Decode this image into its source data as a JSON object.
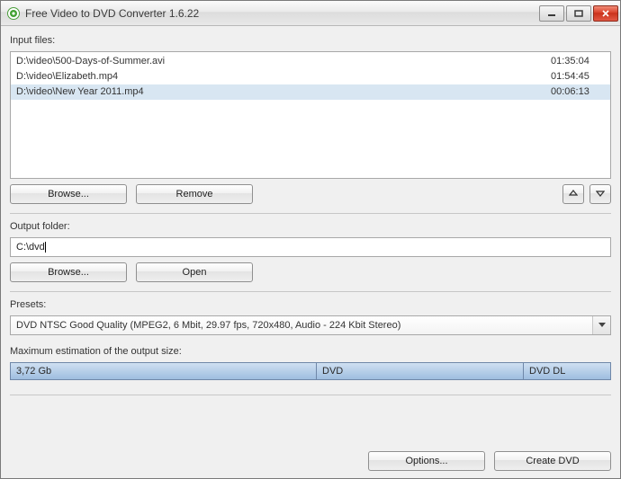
{
  "titlebar": {
    "title": "Free Video to DVD Converter 1.6.22"
  },
  "labels": {
    "input_files": "Input files:",
    "output_folder": "Output folder:",
    "presets": "Presets:",
    "max_est": "Maximum estimation of the output size:"
  },
  "input_files": [
    {
      "path": "D:\\video\\500-Days-of-Summer.avi",
      "duration": "01:35:04",
      "selected": false
    },
    {
      "path": "D:\\video\\Elizabeth.mp4",
      "duration": "01:54:45",
      "selected": false
    },
    {
      "path": "D:\\video\\New Year 2011.mp4",
      "duration": "00:06:13",
      "selected": true
    }
  ],
  "buttons": {
    "browse_files": "Browse...",
    "remove": "Remove",
    "browse_folder": "Browse...",
    "open": "Open",
    "options": "Options...",
    "create": "Create DVD"
  },
  "output_folder": {
    "value": "C:\\dvd"
  },
  "preset": {
    "selected": "DVD NTSC Good Quality (MPEG2, 6 Mbit, 29.97 fps, 720x480, Audio - 224 Kbit Stereo)"
  },
  "estimation": {
    "size": "3,72 Gb",
    "c1": "DVD",
    "c2": "DVD DL"
  }
}
